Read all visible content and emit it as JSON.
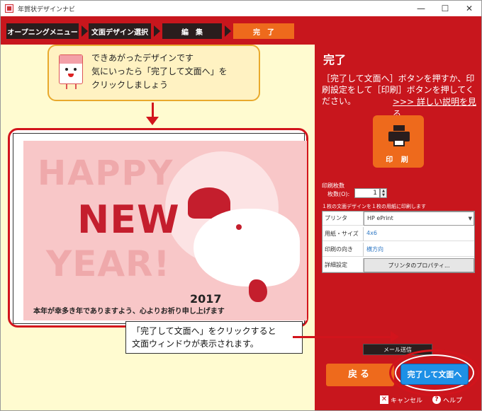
{
  "window": {
    "title": "年賀状デザインナビ",
    "controls": [
      "—",
      "☐",
      "✕"
    ]
  },
  "steps": [
    {
      "label": "オープニングメニュー"
    },
    {
      "label": "文面デザイン選択"
    },
    {
      "label": "編　集"
    },
    {
      "label": "完　了"
    }
  ],
  "bubble": {
    "line1": "できあがったデザインです",
    "line2": "気にいったら「完了して文面へ」を",
    "line3": "クリックしましょう"
  },
  "card": {
    "happy": "HAPPY",
    "new": "NEW",
    "year": "YEAR!",
    "year_number": "2017",
    "greeting": "本年が幸多き年でありますよう、心よりお祈り申し上げます"
  },
  "note": {
    "line1": "「完了して文面へ」をクリックすると",
    "line2": "文面ウィンドウが表示されます。"
  },
  "panel": {
    "title": "完了",
    "description": "［完了して文面へ］ボタンを押すか、印刷設定をして［印刷］ボタンを押してください。",
    "more_link": ">>> 詳しい説明を見る",
    "print_label": "印 刷",
    "print_section": "印刷枚数",
    "count_label": "枚数(O):",
    "count_value": "1",
    "info": "１枚の文面デザインを１枚の用紙に印刷します",
    "rows": [
      {
        "key": "プリンタ",
        "value": "HP ePrint"
      },
      {
        "key": "用紙・サイズ",
        "value": "4x6"
      },
      {
        "key": "印刷の向き",
        "value": "横方向"
      },
      {
        "key": "詳細設定",
        "value": "プリンタのプロパティ..."
      }
    ],
    "mail_button": "メール送信",
    "back_button": "戻る",
    "finish_button": "完了して文面へ",
    "cancel_label": "キャンセル",
    "help_label": "ヘルプ"
  },
  "colors": {
    "accent_red": "#c8161d",
    "orange": "#ee6a1c",
    "blue": "#1e90e6",
    "cream": "#fffbd0"
  }
}
